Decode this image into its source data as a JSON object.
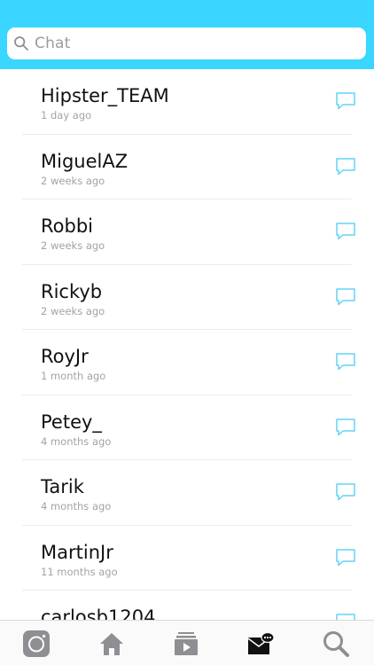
{
  "search": {
    "placeholder": "Chat"
  },
  "colors": {
    "header": "#3ad6ff",
    "accent": "#62d3f5"
  },
  "chats": [
    {
      "name": "Hipster_TEAM",
      "time": "1 day ago"
    },
    {
      "name": "MiguelAZ",
      "time": "2 weeks ago"
    },
    {
      "name": "Robbi",
      "time": "2 weeks ago"
    },
    {
      "name": "Rickyb",
      "time": "2 weeks ago"
    },
    {
      "name": "RoyJr",
      "time": "1 month ago"
    },
    {
      "name": "Petey_",
      "time": "4 months ago"
    },
    {
      "name": "Tarik",
      "time": "4 months ago"
    },
    {
      "name": "MartinJr",
      "time": "11 months ago"
    },
    {
      "name": "carlosb1204",
      "time": ""
    }
  ],
  "tabbar": {
    "items": [
      {
        "icon": "camera-icon",
        "active": false
      },
      {
        "icon": "home-icon",
        "active": false
      },
      {
        "icon": "video-stack-icon",
        "active": false
      },
      {
        "icon": "messages-icon",
        "active": true
      },
      {
        "icon": "search-icon",
        "active": false
      }
    ]
  }
}
